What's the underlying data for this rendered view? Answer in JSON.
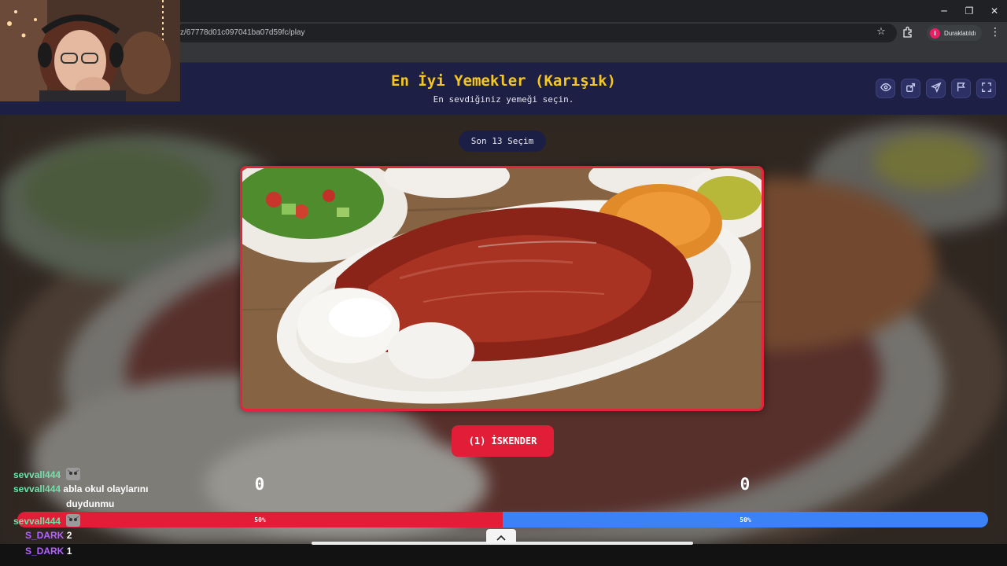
{
  "browser": {
    "url": "z/67778d01c097041ba07d59fc/play",
    "profile_label": "Duraklatıldı",
    "profile_initial": "i",
    "window_controls": {
      "minimize": "─",
      "restore": "❐",
      "close": "✕"
    }
  },
  "header": {
    "title": "En İyi Yemekler (Karışık)",
    "subtitle": "En sevdiğiniz yemeği seçin.",
    "actions": [
      "eye-icon",
      "share-icon",
      "send-icon",
      "flag-icon",
      "fullscreen-icon"
    ]
  },
  "game": {
    "round_label": "Son 13 Seçim",
    "choice_label": "(1) İSKENDER",
    "score_left": "0",
    "score_right": "0",
    "vote_left_pct": 0.5,
    "vote_right_pct": 0.5,
    "vote_left_label": "50%",
    "vote_right_label": "50%",
    "colors": {
      "accent_red": "#e11d38",
      "accent_blue": "#3b82f6",
      "title_yellow": "#f6c71c",
      "header_bg": "#1e1f44"
    }
  },
  "chat": {
    "messages": [
      {
        "user": "sevvall444",
        "text": "",
        "emote": "cat-emote"
      },
      {
        "user": "sevvall444",
        "text": "abla okul olaylarını",
        "emote": ""
      },
      {
        "user": "",
        "text": "duydunmu",
        "emote": ""
      },
      {
        "user": "sevvall444",
        "text": "",
        "emote": "cat-emote"
      },
      {
        "user": "S_DARK",
        "text": "2",
        "emote": ""
      },
      {
        "user": "S_DARK",
        "text": "1",
        "emote": ""
      }
    ]
  }
}
